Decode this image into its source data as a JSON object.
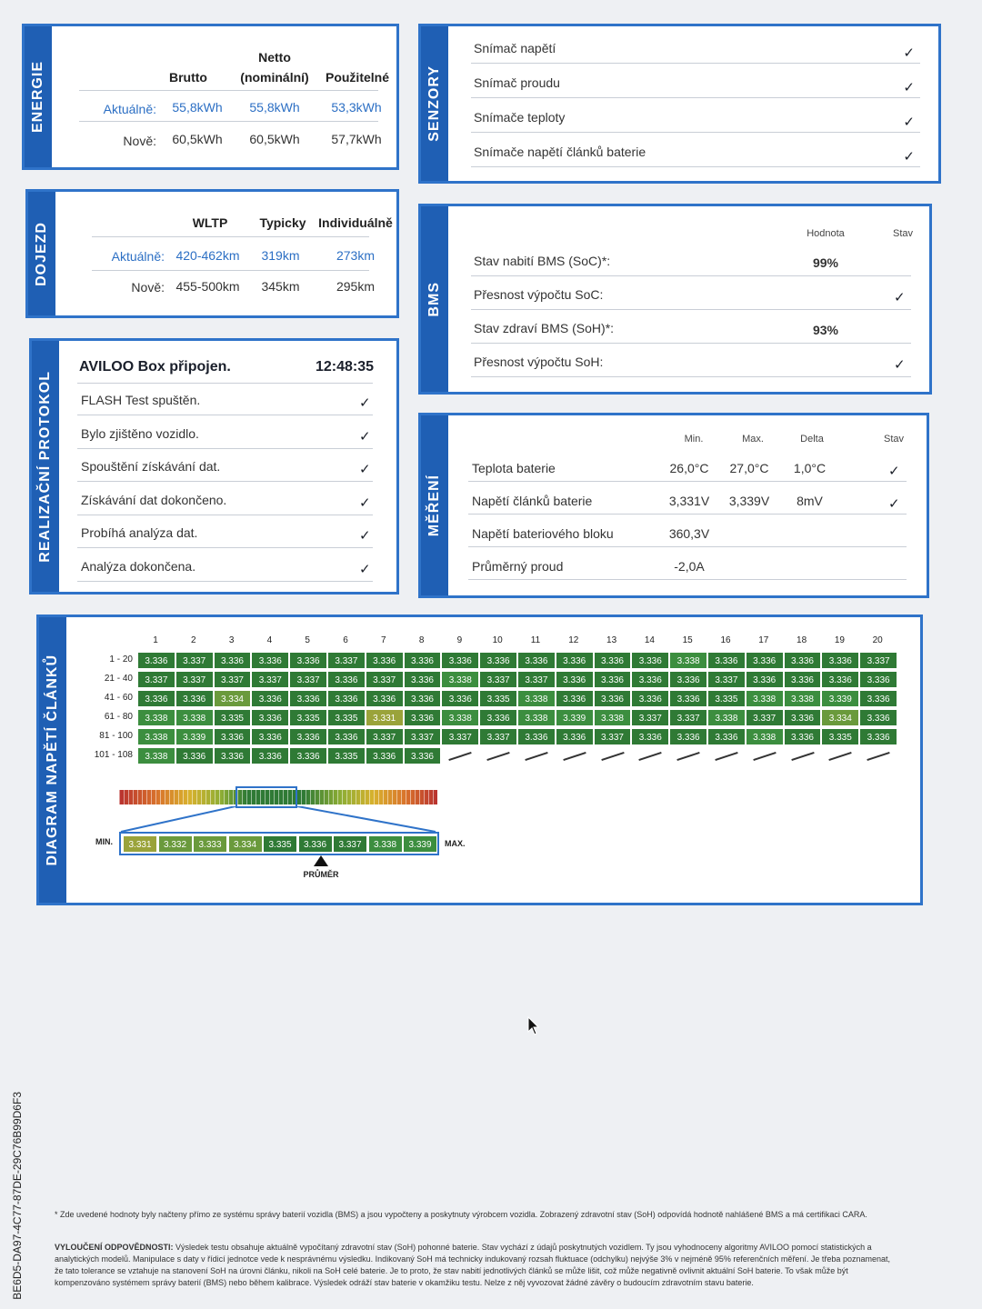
{
  "energie": {
    "title": "ENERGIE",
    "headers": {
      "brutto": "Brutto",
      "netto_line1": "Netto",
      "netto_line2": "(nominální)",
      "pouzitelne": "Použitelné"
    },
    "rows": [
      {
        "label": "Aktuálně:",
        "brutto": "55,8kWh",
        "netto": "55,8kWh",
        "pouzitelne": "53,3kWh"
      },
      {
        "label": "Nově:",
        "brutto": "60,5kWh",
        "netto": "60,5kWh",
        "pouzitelne": "57,7kWh"
      }
    ]
  },
  "senzory": {
    "title": "SENZORY",
    "items": [
      "Snímač napětí",
      "Snímač proudu",
      "Snímače teploty",
      "Snímače napětí článků baterie"
    ],
    "check": "✓"
  },
  "dojezd": {
    "title": "DOJEZD",
    "headers": {
      "wltp": "WLTP",
      "typicky": "Typicky",
      "individualne": "Individuálně"
    },
    "rows": [
      {
        "label": "Aktuálně:",
        "wltp": "420-462km",
        "typicky": "319km",
        "individualne": "273km"
      },
      {
        "label": "Nově:",
        "wltp": "455-500km",
        "typicky": "345km",
        "individualne": "295km"
      }
    ]
  },
  "bms": {
    "title": "BMS",
    "headers": {
      "hodnota": "Hodnota",
      "stav": "Stav"
    },
    "rows": [
      {
        "label": "Stav nabití BMS (SoC)*:",
        "value": "99%"
      },
      {
        "label": "Přesnost výpočtu SoC:",
        "value": ""
      },
      {
        "label": "Stav zdraví BMS (SoH)*:",
        "value": "93%"
      },
      {
        "label": "Přesnost výpočtu SoH:",
        "value": ""
      }
    ]
  },
  "protokol": {
    "title": "REALIZAČNÍ PROTOKOL",
    "status": "AVILOO Box připojen.",
    "time": "12:48:35",
    "items": [
      "FLASH Test spuštěn.",
      "Bylo zjištěno vozidlo.",
      "Spouštění získávání dat.",
      "Získávání dat dokončeno.",
      "Probíhá analýza dat.",
      "Analýza dokončena."
    ]
  },
  "mereni": {
    "title": "MĚŘENÍ",
    "headers": {
      "min": "Min.",
      "max": "Max.",
      "delta": "Delta",
      "stav": "Stav"
    },
    "rows": [
      {
        "label": "Teplota baterie",
        "min": "26,0°C",
        "max": "27,0°C",
        "delta": "1,0°C",
        "check": true
      },
      {
        "label": "Napětí článků baterie",
        "min": "3,331V",
        "max": "3,339V",
        "delta": "8mV",
        "check": true
      },
      {
        "label": "Napětí bateriového bloku",
        "min": "360,3V",
        "max": "",
        "delta": "",
        "check": false
      },
      {
        "label": "Průměrný proud",
        "min": "-2,0A",
        "max": "",
        "delta": "",
        "check": false
      }
    ]
  },
  "diagram": {
    "title": "DIAGRAM NAPĚTÍ ČLÁNKŮ",
    "columns": [
      "1",
      "2",
      "3",
      "4",
      "5",
      "6",
      "7",
      "8",
      "9",
      "10",
      "11",
      "12",
      "13",
      "14",
      "15",
      "16",
      "17",
      "18",
      "19",
      "20"
    ],
    "row_labels": [
      "1 - 20",
      "21 - 40",
      "41 - 60",
      "61 - 80",
      "81 - 100",
      "101 - 108"
    ],
    "rows": [
      [
        "3.336",
        "3.337",
        "3.336",
        "3.336",
        "3.336",
        "3.337",
        "3.336",
        "3.336",
        "3.336",
        "3.336",
        "3.336",
        "3.336",
        "3.336",
        "3.336",
        "3.338",
        "3.336",
        "3.336",
        "3.336",
        "3.336",
        "3.337"
      ],
      [
        "3.337",
        "3.337",
        "3.337",
        "3.337",
        "3.337",
        "3.336",
        "3.337",
        "3.336",
        "3.338",
        "3.337",
        "3.337",
        "3.336",
        "3.336",
        "3.336",
        "3.336",
        "3.337",
        "3.336",
        "3.336",
        "3.336",
        "3.336"
      ],
      [
        "3.336",
        "3.336",
        "3.334",
        "3.336",
        "3.336",
        "3.336",
        "3.336",
        "3.336",
        "3.336",
        "3.335",
        "3.338",
        "3.336",
        "3.336",
        "3.336",
        "3.336",
        "3.335",
        "3.338",
        "3.338",
        "3.339",
        "3.336"
      ],
      [
        "3.338",
        "3.338",
        "3.335",
        "3.336",
        "3.335",
        "3.335",
        "3.331",
        "3.336",
        "3.338",
        "3.336",
        "3.338",
        "3.339",
        "3.338",
        "3.337",
        "3.337",
        "3.338",
        "3.337",
        "3.336",
        "3.334",
        "3.336"
      ],
      [
        "3.338",
        "3.339",
        "3.336",
        "3.336",
        "3.336",
        "3.336",
        "3.337",
        "3.337",
        "3.337",
        "3.337",
        "3.336",
        "3.336",
        "3.337",
        "3.336",
        "3.336",
        "3.336",
        "3.338",
        "3.336",
        "3.335",
        "3.336"
      ],
      [
        "3.338",
        "3.336",
        "3.336",
        "3.336",
        "3.336",
        "3.335",
        "3.336",
        "3.336"
      ]
    ],
    "scale_min_label": "MIN.",
    "scale_max_label": "MAX.",
    "scale_values": [
      "3.331",
      "3.332",
      "3.333",
      "3.334",
      "3.335",
      "3.336",
      "3.337",
      "3.338",
      "3.339"
    ],
    "average_label": "PRŮMĚR",
    "colors": {
      "cell_dark": "#2f7a35",
      "cell_mid": "#3c8e3f",
      "cell_light": "#6a9a3c",
      "cell_low": "#9aa33a",
      "accent": "#2f73c9"
    }
  },
  "side_code": "BE6D5-DA97-4C77-87DE-29C76B99D6F3",
  "footer": {
    "note": "* Zde uvedené hodnoty byly načteny přímo ze systému správy baterií vozidla (BMS) a jsou vypočteny a poskytnuty výrobcem vozidla. Zobrazený zdravotní stav (SoH) odpovídá hodnotě nahlášené BMS a má certifikaci CARA.",
    "disclaimer_title": "VYLOUČENÍ ODPOVĚDNOSTI:",
    "disclaimer": "Výsledek testu obsahuje aktuálně vypočítaný zdravotní stav (SoH) pohonné baterie. Stav vychází z údajů poskytnutých vozidlem. Ty jsou vyhodnoceny algoritmy AVILOO pomocí statistických a analytických modelů. Manipulace s daty v řídicí jednotce vede k nesprávnému výsledku. Indikovaný SoH má technicky indukovaný rozsah fluktuace (odchylku) nejvýše 3% v nejméně 95% referenčních měření. Je třeba poznamenat, že tato tolerance se vztahuje na stanovení SoH na úrovni článku, nikoli na SoH celé baterie. Je to proto, že stav nabití jednotlivých článků se může lišit, což může negativně ovlivnit aktuální SoH baterie. To však může být kompenzováno systémem správy baterií (BMS) nebo během kalibrace. Výsledek odráží stav baterie v okamžiku testu. Nelze z něj vyvozovat žádné závěry o budoucím zdravotním stavu baterie."
  }
}
